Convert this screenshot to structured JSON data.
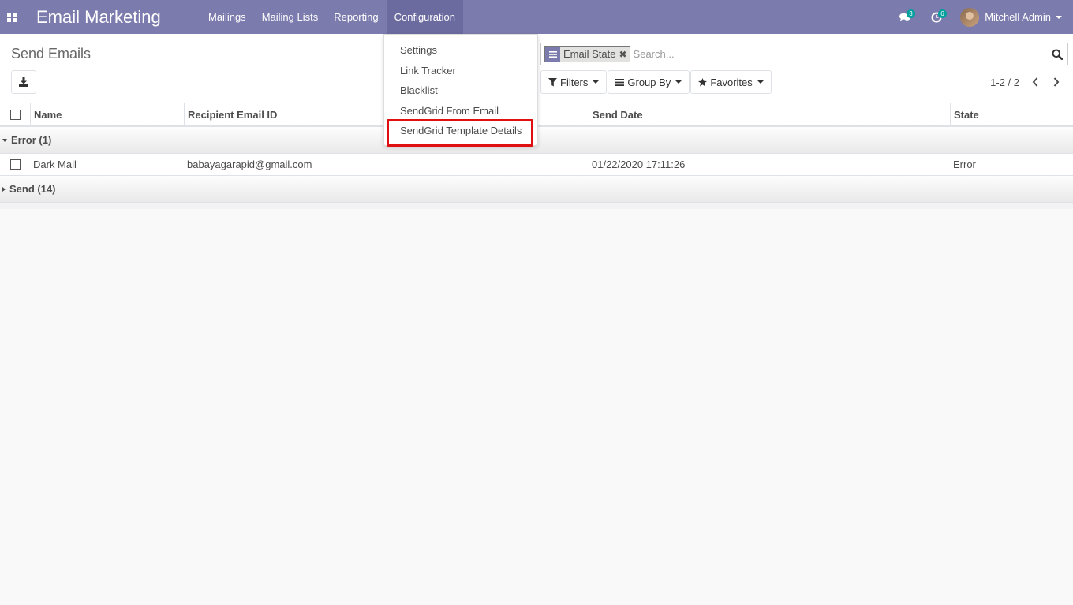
{
  "navbar": {
    "brand": "Email Marketing",
    "menu": [
      {
        "label": "Mailings"
      },
      {
        "label": "Mailing Lists"
      },
      {
        "label": "Reporting"
      },
      {
        "label": "Configuration"
      }
    ],
    "messages_count": "3",
    "activities_count": "6",
    "user_name": "Mitchell Admin",
    "accent_color": "#7c7bad"
  },
  "control": {
    "title": "Send Emails",
    "search": {
      "facet_label": "Email State",
      "placeholder": "Search..."
    },
    "filters_label": "Filters",
    "groupby_label": "Group By",
    "favorites_label": "Favorites",
    "pager_value": "1-2 / 2"
  },
  "table": {
    "headers": {
      "name": "Name",
      "recipient": "Recipient Email ID",
      "send_date": "Send Date",
      "state": "State"
    },
    "groups": [
      {
        "label": "Error (1)",
        "expanded": true,
        "rows": [
          {
            "name": "Dark Mail",
            "recipient": "babayagarapid@gmail.com",
            "send_date": "01/22/2020 17:11:26",
            "state": "Error"
          }
        ]
      },
      {
        "label": "Send (14)",
        "expanded": false,
        "rows": []
      }
    ]
  },
  "dropdown": {
    "items": [
      {
        "label": "Settings"
      },
      {
        "label": "Link Tracker"
      },
      {
        "label": "Blacklist"
      },
      {
        "label": "SendGrid From Email"
      },
      {
        "label": "SendGrid Template Details",
        "highlighted": true
      }
    ],
    "highlight_color": "#e01010"
  }
}
